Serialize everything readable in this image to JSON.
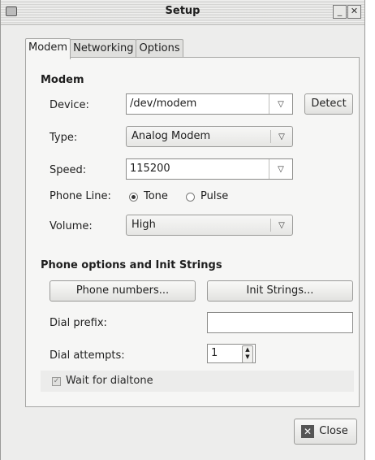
{
  "window": {
    "title": "Setup"
  },
  "tabs": [
    "Modem",
    "Networking",
    "Options"
  ],
  "modem_section": {
    "heading": "Modem",
    "device_label": "Device:",
    "device_value": "/dev/modem",
    "detect_button": "Detect",
    "type_label": "Type:",
    "type_value": "Analog Modem",
    "speed_label": "Speed:",
    "speed_value": "115200",
    "phone_line_label": "Phone Line:",
    "tone_label": "Tone",
    "pulse_label": "Pulse",
    "phone_line_selected": "Tone",
    "volume_label": "Volume:",
    "volume_value": "High"
  },
  "phone_section": {
    "heading": "Phone options and Init Strings",
    "phone_numbers_button": "Phone numbers...",
    "init_strings_button": "Init Strings...",
    "dial_prefix_label": "Dial prefix:",
    "dial_prefix_value": "",
    "dial_attempts_label": "Dial attempts:",
    "dial_attempts_value": "1",
    "wait_dialtone_label": "Wait for dialtone",
    "wait_dialtone_checked": true
  },
  "footer": {
    "close_button": "Close"
  },
  "icons": {
    "window": "window-menu-icon",
    "minimize": "minimize-icon",
    "close": "close-icon",
    "close_button": "close-x-icon"
  }
}
